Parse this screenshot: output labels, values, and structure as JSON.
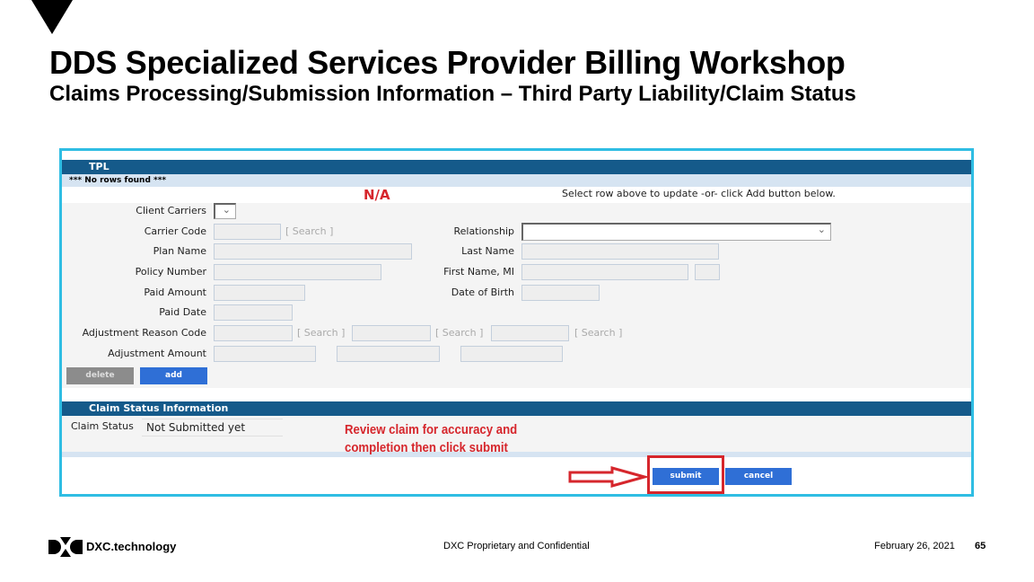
{
  "slide": {
    "title": "DDS Specialized Services Provider Billing Workshop",
    "subtitle": "Claims Processing/Submission Information – Third Party Liability/Claim Status"
  },
  "tpl": {
    "header": "TPL",
    "no_rows": "*** No rows found ***",
    "na_note": "N/A",
    "instruction": "Select row above to update -or- click Add button below.",
    "fields": {
      "client_carriers": "Client Carriers",
      "carrier_code": "Carrier Code",
      "plan_name": "Plan Name",
      "policy_number": "Policy Number",
      "paid_amount": "Paid Amount",
      "paid_date": "Paid Date",
      "adjustment_reason_code": "Adjustment Reason Code",
      "adjustment_amount": "Adjustment Amount",
      "relationship": "Relationship",
      "last_name": "Last Name",
      "first_name_mi": "First Name, MI",
      "date_of_birth": "Date of Birth"
    },
    "search_label": "[ Search ]",
    "delete_label": "delete",
    "add_label": "add"
  },
  "claim_status": {
    "header": "Claim Status Information",
    "label": "Claim Status",
    "value": "Not Submitted yet",
    "annotation_line1": "Review claim for accuracy and",
    "annotation_line2": "completion then click submit",
    "submit_label": "submit",
    "cancel_label": "cancel"
  },
  "footer": {
    "brand": "DXC.technology",
    "confidential": "DXC Proprietary and Confidential",
    "date": "February 26, 2021",
    "page": "65"
  },
  "colors": {
    "header_bar": "#155a8a",
    "button_blue": "#2f6fd6",
    "annotation_red": "#d6262c",
    "frame": "#2fbde3"
  }
}
